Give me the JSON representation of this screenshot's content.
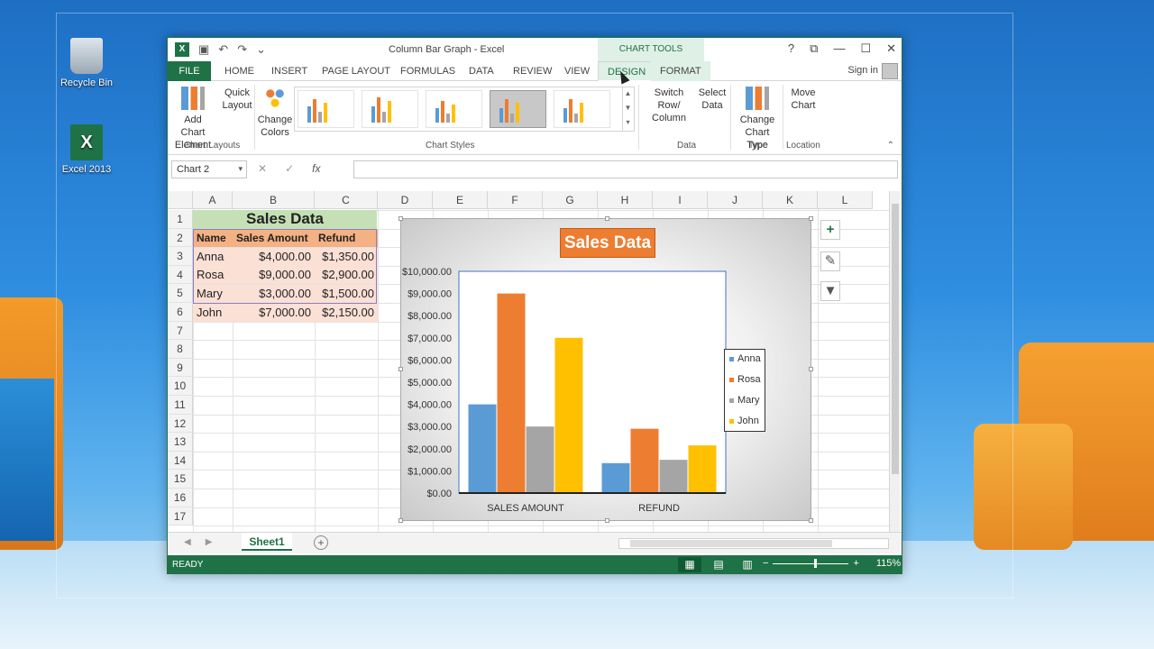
{
  "desktop": {
    "icons": [
      {
        "label": "Recycle Bin",
        "icon": "recycle-bin-icon"
      },
      {
        "label": "Excel 2013",
        "icon": "excel-icon"
      }
    ]
  },
  "window": {
    "title": "Column Bar Graph - Excel",
    "chart_tools_label": "CHART TOOLS",
    "controls": [
      "?",
      "⧉",
      "—",
      "☐",
      "✕"
    ],
    "signin": "Sign in"
  },
  "tabs": [
    "FILE",
    "HOME",
    "INSERT",
    "PAGE LAYOUT",
    "FORMULAS",
    "DATA",
    "REVIEW",
    "VIEW",
    "DESIGN",
    "FORMAT"
  ],
  "ribbon": {
    "add_chart_element": [
      "Add Chart",
      "Element"
    ],
    "quick_layout": [
      "Quick",
      "Layout"
    ],
    "change_colors": [
      "Change",
      "Colors"
    ],
    "switch_row_col": [
      "Switch Row/",
      "Column"
    ],
    "select_data": [
      "Select",
      "Data"
    ],
    "change_chart_type": [
      "Change",
      "Chart Type"
    ],
    "move_chart": [
      "Move",
      "Chart"
    ],
    "groups": {
      "chart_layouts": "Chart Layouts",
      "chart_styles": "Chart Styles",
      "data": "Data",
      "type": "Type",
      "location": "Location"
    }
  },
  "formula_bar": {
    "name_box": "Chart 2",
    "fx": "fx",
    "value": ""
  },
  "columns": [
    "A",
    "B",
    "C",
    "D",
    "E",
    "F",
    "G",
    "H",
    "I",
    "J",
    "K",
    "L"
  ],
  "rows": [
    "1",
    "2",
    "3",
    "4",
    "5",
    "6",
    "7",
    "8",
    "9",
    "10",
    "11",
    "12",
    "13",
    "14",
    "15",
    "16",
    "17"
  ],
  "sheet": {
    "title": "Sales Data",
    "headers": [
      "Name",
      "Sales Amount",
      "Refund"
    ],
    "rows": [
      [
        "Anna",
        "$4,000.00",
        "$1,350.00"
      ],
      [
        "Rosa",
        "$9,000.00",
        "$2,900.00"
      ],
      [
        "Mary",
        "$3,000.00",
        "$1,500.00"
      ],
      [
        "John",
        "$7,000.00",
        "$2,150.00"
      ]
    ]
  },
  "chart_data": {
    "type": "bar",
    "title": "Sales Data",
    "categories": [
      "SALES AMOUNT",
      "REFUND"
    ],
    "series": [
      {
        "name": "Anna",
        "values": [
          4000,
          1350
        ],
        "color": "#5b9bd5"
      },
      {
        "name": "Rosa",
        "values": [
          9000,
          2900
        ],
        "color": "#ed7d31"
      },
      {
        "name": "Mary",
        "values": [
          3000,
          1500
        ],
        "color": "#a5a5a5"
      },
      {
        "name": "John",
        "values": [
          7000,
          2150
        ],
        "color": "#ffc000"
      }
    ],
    "ylim": [
      0,
      10000
    ],
    "ytick_labels": [
      "$0.00",
      "$1,000.00",
      "$2,000.00",
      "$3,000.00",
      "$4,000.00",
      "$5,000.00",
      "$6,000.00",
      "$7,000.00",
      "$8,000.00",
      "$9,000.00",
      "$10,000.00"
    ],
    "legend": "right",
    "grid": false
  },
  "sheet_tabs": {
    "active": "Sheet1"
  },
  "status": {
    "mode": "READY",
    "zoom": "115%"
  },
  "colors": {
    "excel_green": "#1f7246",
    "title_fill": "#c5e0b4",
    "header_fill": "#f4b183",
    "data_fill": "#fbe0d6"
  }
}
